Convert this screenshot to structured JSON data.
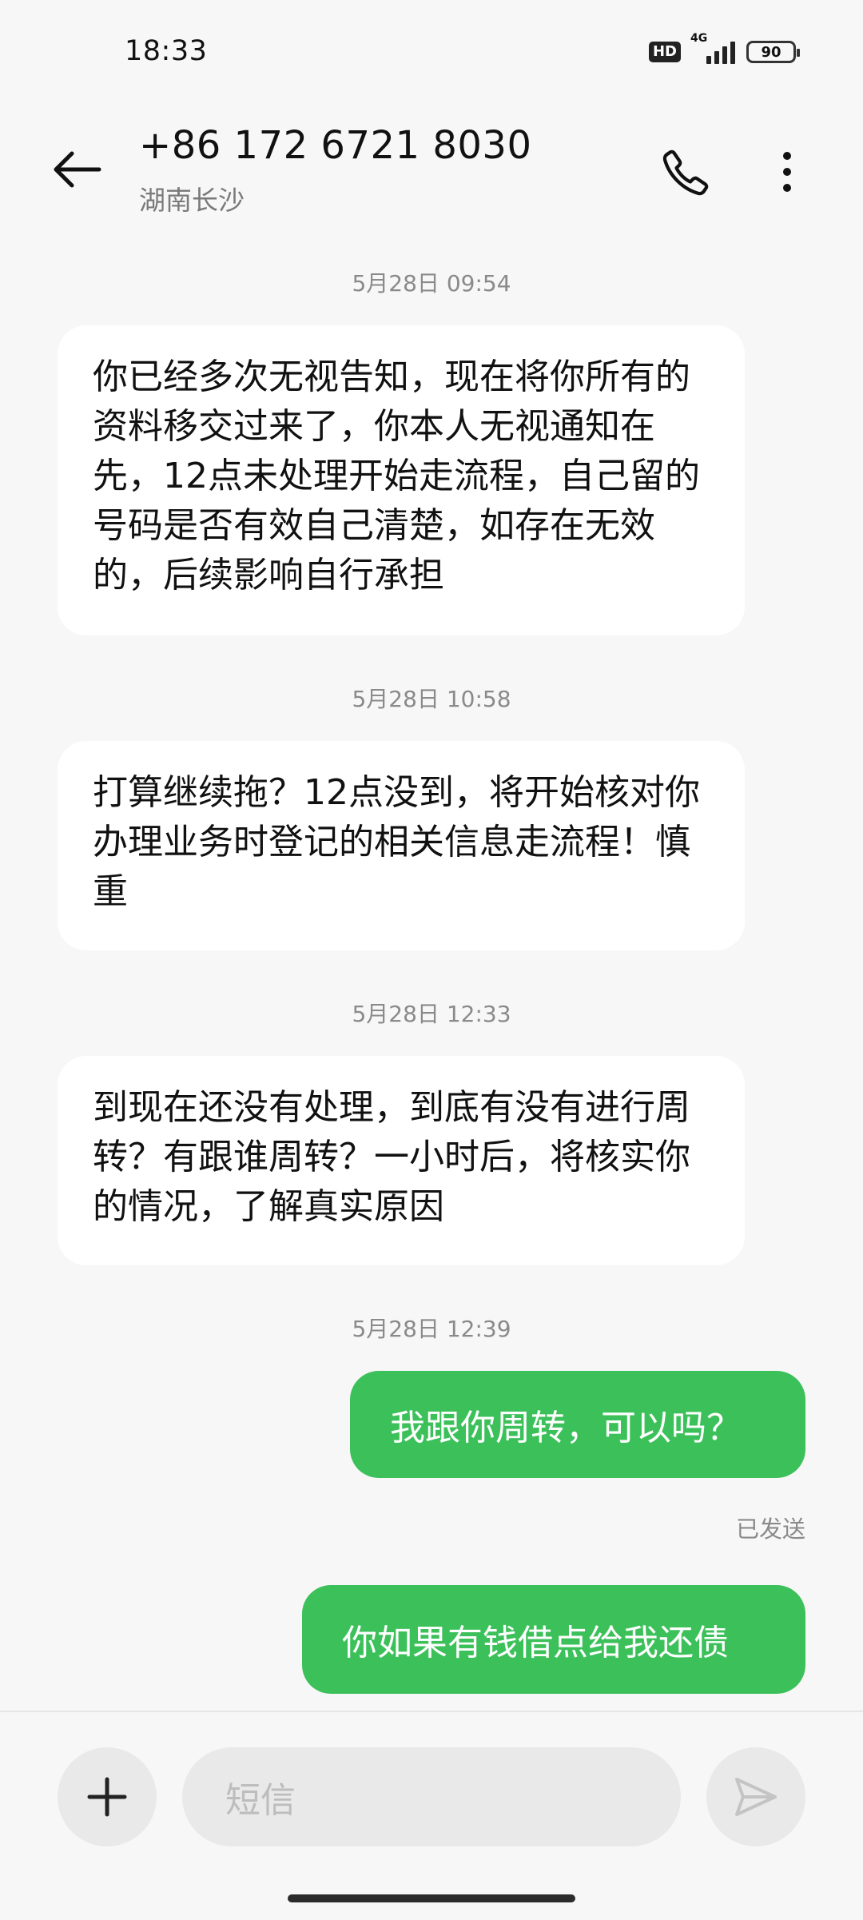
{
  "status_bar": {
    "time": "18:33",
    "hd_label": "HD",
    "network_label": "4G",
    "battery_level": "90"
  },
  "header": {
    "contact_number": "+86 172 6721 8030",
    "contact_location": "湖南长沙"
  },
  "messages": [
    {
      "timestamp": "5月28日 09:54",
      "direction": "incoming",
      "text": "你已经多次无视告知，现在将你所有的资料移交过来了，你本人无视通知在先，12点未处理开始走流程，自己留的号码是否有效自己清楚，如存在无效的，后续影响自行承担"
    },
    {
      "timestamp": "5月28日 10:58",
      "direction": "incoming",
      "text": "打算继续拖？12点没到，将开始核对你办理业务时登记的相关信息走流程！慎重"
    },
    {
      "timestamp": "5月28日 12:33",
      "direction": "incoming",
      "text": "到现在还没有处理，到底有没有进行周转？有跟谁周转？一小时后，将核实你的情况，了解真实原因"
    },
    {
      "timestamp": "5月28日 12:39",
      "direction": "outgoing",
      "text": "我跟你周转，可以吗？",
      "status": "已发送"
    },
    {
      "direction": "outgoing",
      "text": "你如果有钱借点给我还债"
    }
  ],
  "composer": {
    "placeholder": "短信"
  },
  "colors": {
    "outgoing_bubble": "#3cc15a",
    "incoming_bubble": "#ffffff",
    "background": "#f7f7f7"
  },
  "icons": [
    "back-arrow-icon",
    "phone-icon",
    "more-vertical-icon",
    "plus-icon",
    "send-icon"
  ]
}
